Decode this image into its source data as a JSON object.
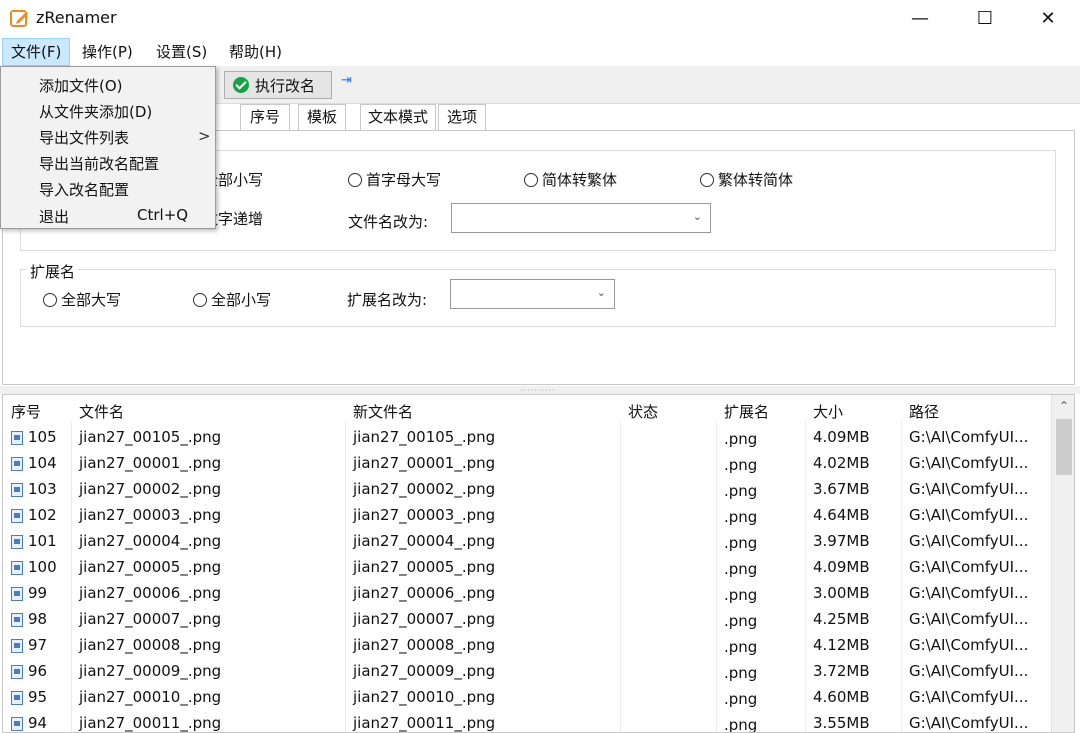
{
  "window": {
    "title": "zRenamer",
    "minimize_glyph": "—",
    "maximize_glyph": "☐",
    "close_glyph": "✕"
  },
  "menubar": {
    "file": "文件(F)",
    "operate": "操作(P)",
    "settings": "设置(S)",
    "help": "帮助(H)"
  },
  "file_menu": {
    "items": [
      "添加文件(O)",
      "从文件夹添加(D)",
      "导出文件列表",
      "导出当前改名配置",
      "导入改名配置",
      "退出"
    ],
    "submenu_arrow": ">",
    "exit_shortcut": "Ctrl+Q"
  },
  "toolbar": {
    "execute_label": "执行改名",
    "pin_glyph": "⇥"
  },
  "tabs": [
    "序号",
    "模板",
    "文本模式",
    "选项"
  ],
  "filename_group": {
    "radios": [
      "全部小写",
      "首字母大写",
      "简体转繁体",
      "繁体转简体",
      "数字递增"
    ],
    "rename_label": "文件名改为:",
    "rename_value": ""
  },
  "extension_group": {
    "title": "扩展名",
    "radios": [
      "全部大写",
      "全部小写"
    ],
    "rename_label": "扩展名改为:",
    "rename_value": ""
  },
  "splitter_dots": "··········",
  "table": {
    "headers": [
      "序号",
      "文件名",
      "新文件名",
      "状态",
      "扩展名",
      "大小",
      "路径"
    ],
    "rows": [
      [
        "105",
        "jian27_00105_.png",
        "jian27_00105_.png",
        "",
        ".png",
        "4.09MB",
        "G:\\AI\\ComfyUI..."
      ],
      [
        "104",
        "jian27_00001_.png",
        "jian27_00001_.png",
        "",
        ".png",
        "4.02MB",
        "G:\\AI\\ComfyUI..."
      ],
      [
        "103",
        "jian27_00002_.png",
        "jian27_00002_.png",
        "",
        ".png",
        "3.67MB",
        "G:\\AI\\ComfyUI..."
      ],
      [
        "102",
        "jian27_00003_.png",
        "jian27_00003_.png",
        "",
        ".png",
        "4.64MB",
        "G:\\AI\\ComfyUI..."
      ],
      [
        "101",
        "jian27_00004_.png",
        "jian27_00004_.png",
        "",
        ".png",
        "3.97MB",
        "G:\\AI\\ComfyUI..."
      ],
      [
        "100",
        "jian27_00005_.png",
        "jian27_00005_.png",
        "",
        ".png",
        "4.09MB",
        "G:\\AI\\ComfyUI..."
      ],
      [
        "99",
        "jian27_00006_.png",
        "jian27_00006_.png",
        "",
        ".png",
        "3.00MB",
        "G:\\AI\\ComfyUI..."
      ],
      [
        "98",
        "jian27_00007_.png",
        "jian27_00007_.png",
        "",
        ".png",
        "4.25MB",
        "G:\\AI\\ComfyUI..."
      ],
      [
        "97",
        "jian27_00008_.png",
        "jian27_00008_.png",
        "",
        ".png",
        "4.12MB",
        "G:\\AI\\ComfyUI..."
      ],
      [
        "96",
        "jian27_00009_.png",
        "jian27_00009_.png",
        "",
        ".png",
        "3.72MB",
        "G:\\AI\\ComfyUI..."
      ],
      [
        "95",
        "jian27_00010_.png",
        "jian27_00010_.png",
        "",
        ".png",
        "4.60MB",
        "G:\\AI\\ComfyUI..."
      ],
      [
        "94",
        "jian27_00011_.png",
        "jian27_00011_.png",
        "",
        ".png",
        "3.55MB",
        "G:\\AI\\ComfyUI..."
      ]
    ]
  },
  "colors": {
    "menu_active_bg": "#cce8ff",
    "check_green": "#16a34a",
    "pin_blue": "#2b7bd8",
    "file_icon_blue": "#4a7ebb"
  }
}
